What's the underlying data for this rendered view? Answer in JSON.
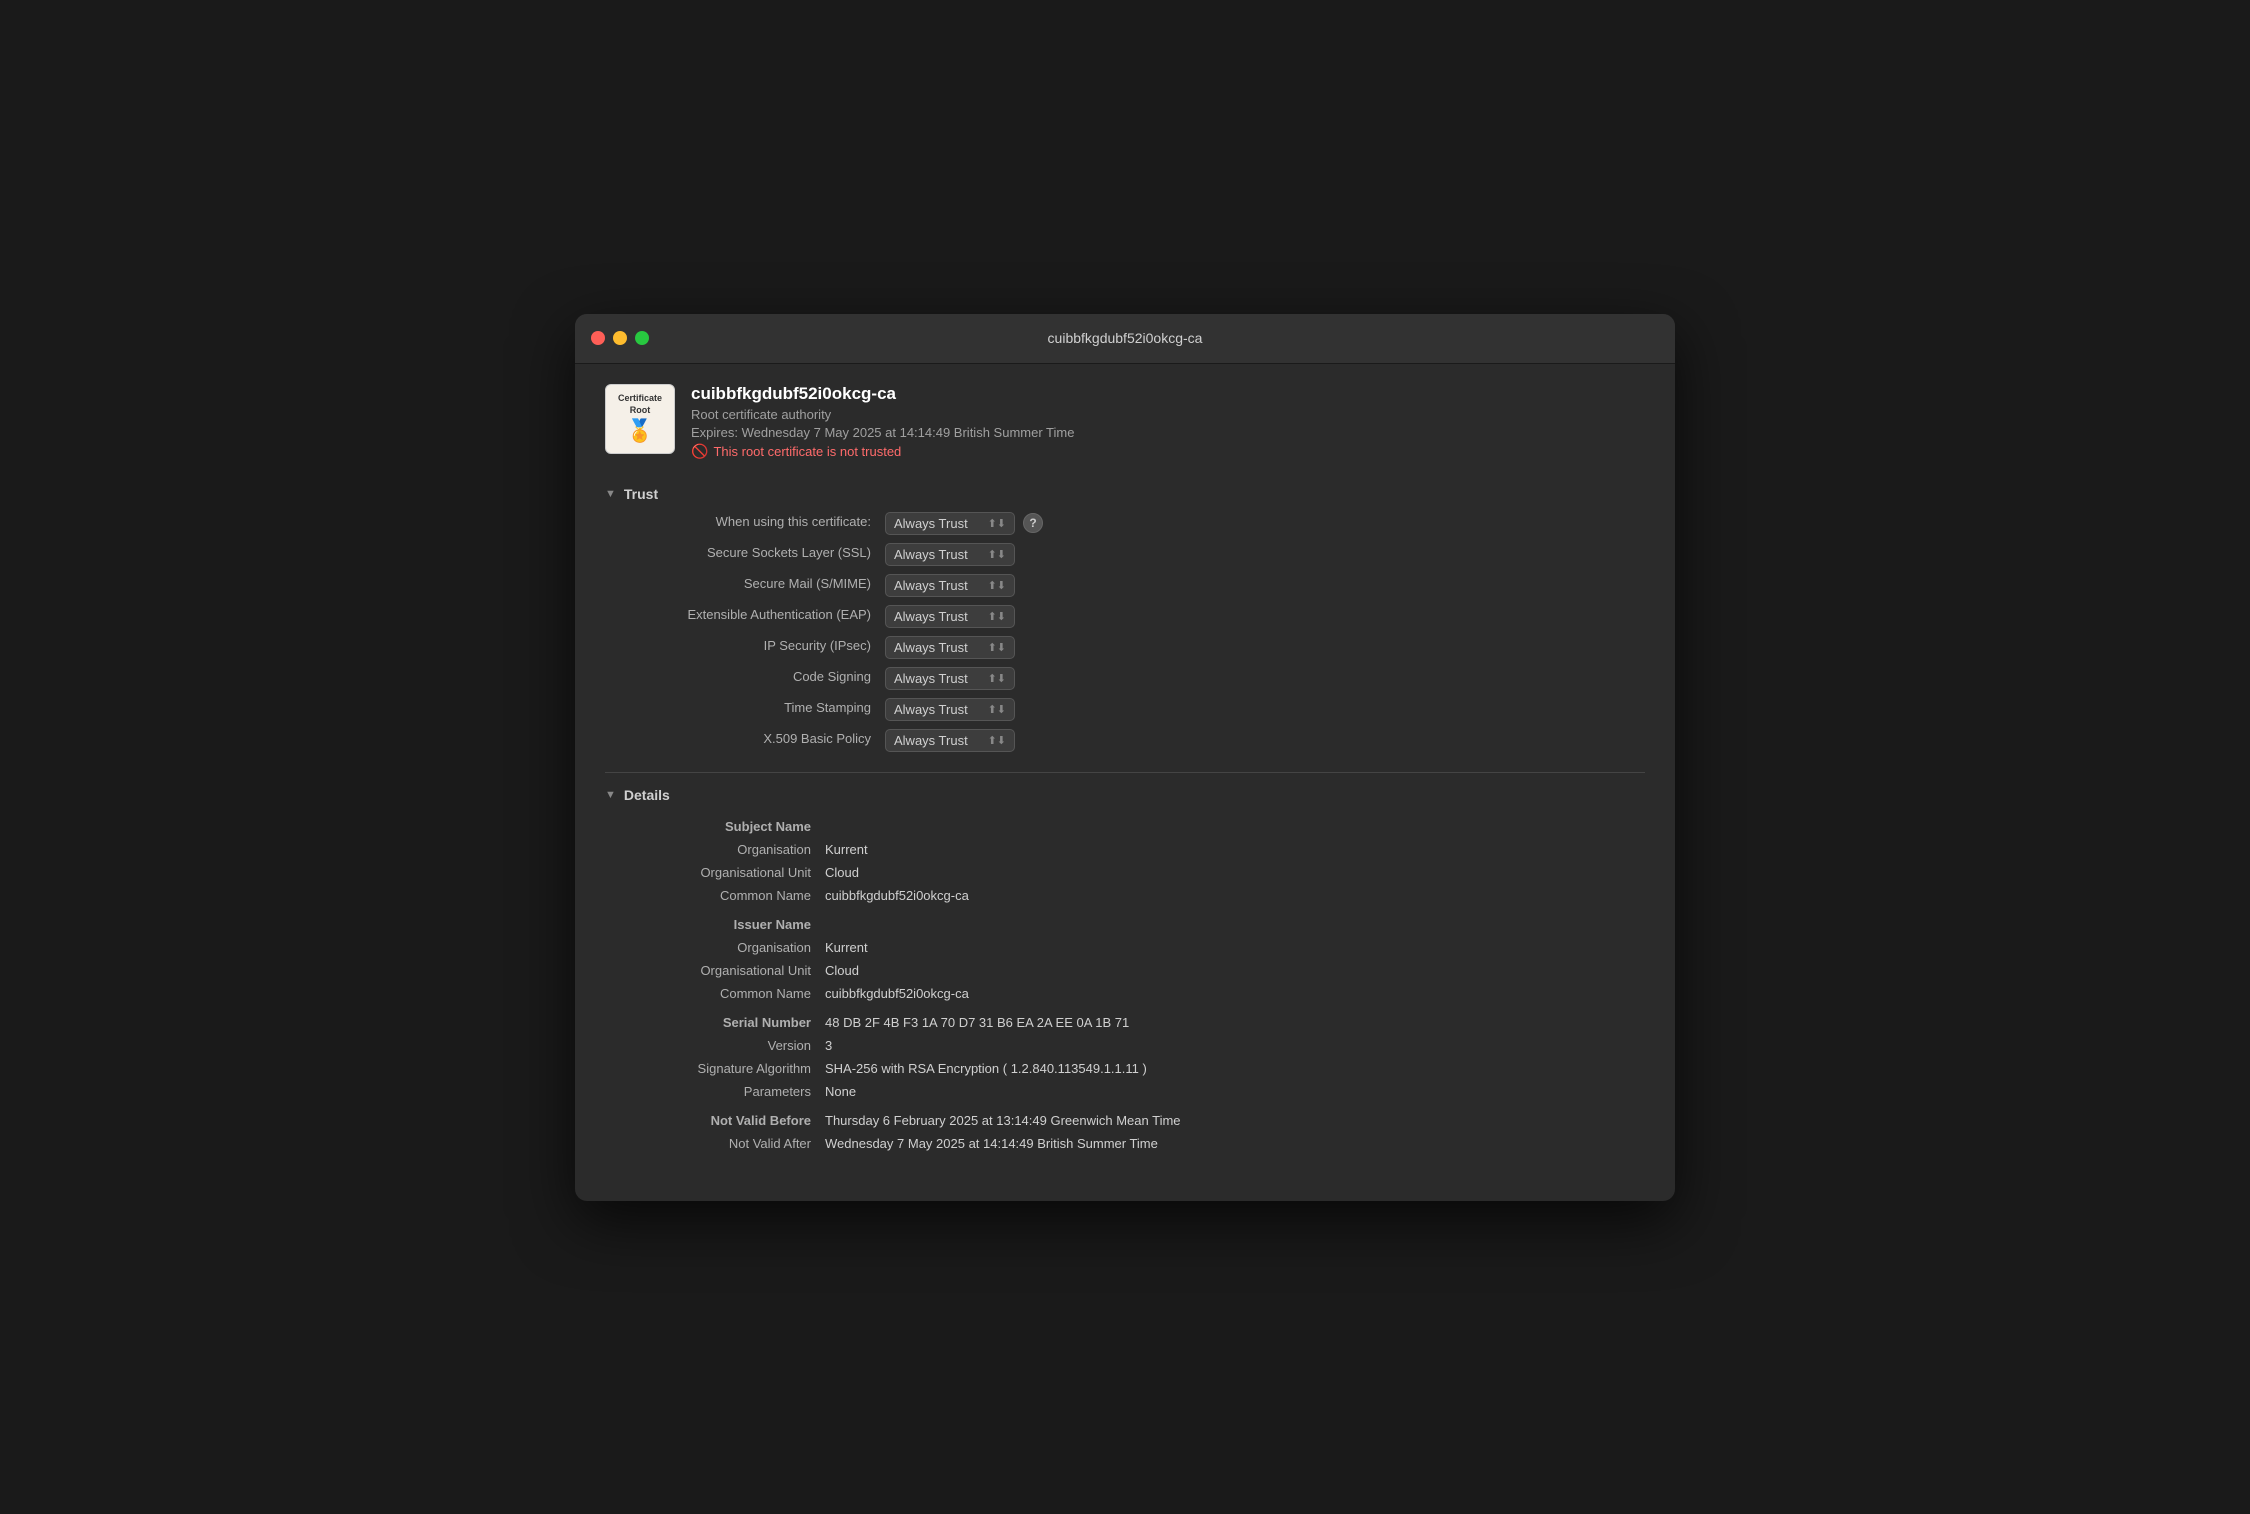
{
  "window": {
    "title": "cuibbfkgdubf52i0okcg-ca"
  },
  "cert": {
    "name": "cuibbfkgdubf52i0okcg-ca",
    "type": "Root certificate authority",
    "expires": "Expires: Wednesday 7 May 2025 at 14:14:49 British Summer Time",
    "warning": "This root certificate is not trusted"
  },
  "trust": {
    "section_label": "Trust",
    "when_using_label": "When using this certificate:",
    "when_using_value": "Always Trust",
    "help_label": "?",
    "rows": [
      {
        "label": "Secure Sockets Layer (SSL)",
        "value": "Always Trust"
      },
      {
        "label": "Secure Mail (S/MIME)",
        "value": "Always Trust"
      },
      {
        "label": "Extensible Authentication (EAP)",
        "value": "Always Trust"
      },
      {
        "label": "IP Security (IPsec)",
        "value": "Always Trust"
      },
      {
        "label": "Code Signing",
        "value": "Always Trust"
      },
      {
        "label": "Time Stamping",
        "value": "Always Trust"
      },
      {
        "label": "X.509 Basic Policy",
        "value": "Always Trust"
      }
    ]
  },
  "details": {
    "section_label": "Details",
    "subject_name_label": "Subject Name",
    "subject": {
      "organisation_label": "Organisation",
      "organisation_value": "Kurrent",
      "org_unit_label": "Organisational Unit",
      "org_unit_value": "Cloud",
      "common_name_label": "Common Name",
      "common_name_value": "cuibbfkgdubf52i0okcg-ca"
    },
    "issuer_name_label": "Issuer Name",
    "issuer": {
      "organisation_label": "Organisation",
      "organisation_value": "Kurrent",
      "org_unit_label": "Organisational Unit",
      "org_unit_value": "Cloud",
      "common_name_label": "Common Name",
      "common_name_value": "cuibbfkgdubf52i0okcg-ca"
    },
    "serial_number_label": "Serial Number",
    "serial_number_value": "48 DB 2F 4B F3 1A 70 D7 31 B6 EA 2A EE 0A 1B 71",
    "version_label": "Version",
    "version_value": "3",
    "sig_algo_label": "Signature Algorithm",
    "sig_algo_value": "SHA-256 with RSA Encryption ( 1.2.840.113549.1.1.11 )",
    "parameters_label": "Parameters",
    "parameters_value": "None",
    "not_valid_before_label": "Not Valid Before",
    "not_valid_before_value": "Thursday 6 February 2025 at 13:14:49 Greenwich Mean Time",
    "not_valid_after_label": "Not Valid After",
    "not_valid_after_value": "Wednesday 7 May 2025 at 14:14:49 British Summer Time"
  }
}
